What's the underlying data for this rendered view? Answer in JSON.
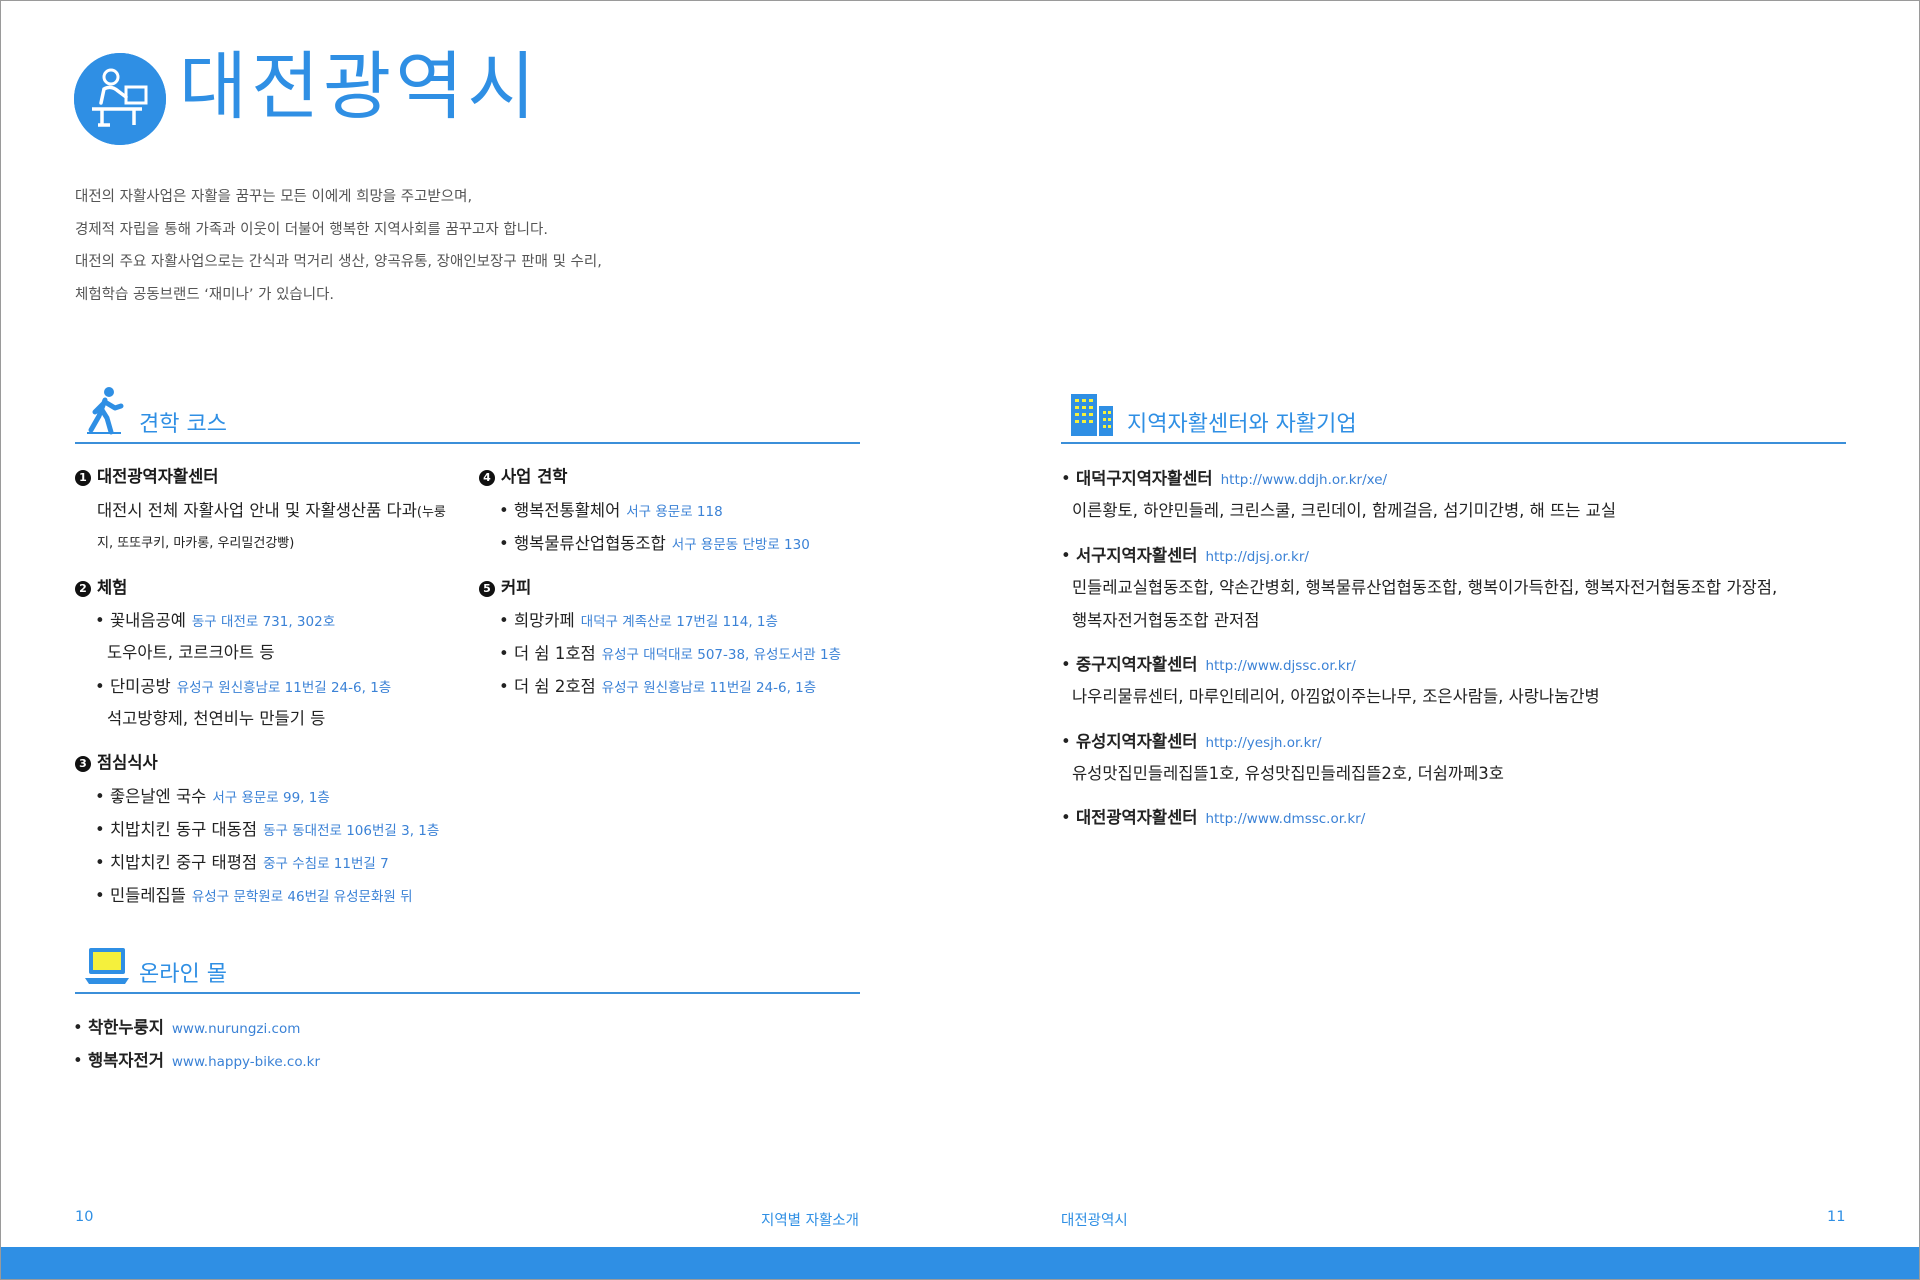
{
  "title": "대전광역시",
  "intro": [
    "대전의 자활사업은 자활을 꿈꾸는 모든 이에게 희망을 주고받으며,",
    "경제적 자립을 통해 가족과 이웃이 더불어 행복한 지역사회를 꿈꾸고자 합니다.",
    "대전의 주요 자활사업으로는 간식과 먹거리 생산, 양곡유통, 장애인보장구 판매 및 수리,",
    "체험학습 공동브랜드 ‘재미나’ 가 있습니다."
  ],
  "tour": {
    "title": "견학 코스",
    "s1": {
      "num": "1",
      "title": "대전광역자활센터",
      "desc1": "대전시 전체 자활사업 안내 및 자활생산품 다과",
      "desc1_small": "(누룽",
      "desc2": "지, 또또쿠키, 마카롱, 우리밀건강빵)"
    },
    "s2": {
      "num": "2",
      "title": "체험",
      "i1": {
        "name": "꽃내음공예",
        "addr": "동구 대전로 731, 302호",
        "sub": "도우아트, 코르크아트 등"
      },
      "i2": {
        "name": "단미공방",
        "addr": "유성구 원신흥남로 11번길 24-6, 1층",
        "sub": "석고방향제, 천연비누 만들기 등"
      }
    },
    "s3": {
      "num": "3",
      "title": "점심식사",
      "i1": {
        "name": "좋은날엔 국수",
        "addr": "서구 용문로 99, 1층"
      },
      "i2": {
        "name": "치밥치킨 동구 대동점",
        "addr": "동구 동대전로 106번길 3, 1층"
      },
      "i3": {
        "name": "치밥치킨 중구 태평점",
        "addr": "중구 수침로 11번길 7"
      },
      "i4": {
        "name": "민들레집뜰",
        "addr": "유성구 문학원로 46번길 유성문화원 뒤"
      }
    },
    "s4": {
      "num": "4",
      "title": "사업 견학",
      "i1": {
        "name": "행복전통활체어",
        "addr": "서구 용문로 118"
      },
      "i2": {
        "name": "행복물류산업협동조합",
        "addr": "서구 용문동 단방로 130"
      }
    },
    "s5": {
      "num": "5",
      "title": "커피",
      "i1": {
        "name": "희망카페",
        "addr": "대덕구 계족산로 17번길 114, 1층"
      },
      "i2": {
        "name": "더 쉼 1호점",
        "addr": "유성구 대덕대로 507-38, 유성도서관 1층"
      },
      "i3": {
        "name": "더 쉼 2호점",
        "addr": "유성구 원신흥남로 11번길 24-6, 1층"
      }
    }
  },
  "mall": {
    "title": "온라인 몰",
    "i1": {
      "name": "착한누룽지",
      "url": "www.nurungzi.com"
    },
    "i2": {
      "name": "행복자전거",
      "url": "www.happy-bike.co.kr"
    }
  },
  "centers": {
    "title": "지역자활센터와 자활기업",
    "c1": {
      "name": "대덕구지역자활센터",
      "url": "http://www.ddjh.or.kr/xe/",
      "desc": "이른황토, 하얀민들레, 크린스쿨, 크린데이, 함께걸음, 섬기미간병, 해 뜨는 교실"
    },
    "c2": {
      "name": "서구지역자활센터",
      "url": "http://djsj.or.kr/",
      "desc1": "민들레교실협동조합, 약손간병회, 행복물류산업협동조합, 행복이가득한집, 행복자전거협동조합 가장점,",
      "desc2": "행복자전거협동조합 관저점"
    },
    "c3": {
      "name": "중구지역자활센터",
      "url": "http://www.djssc.or.kr/",
      "desc": "나우리물류센터, 마루인테리어, 아낌없이주는나무, 조은사람들, 사랑나눔간병"
    },
    "c4": {
      "name": "유성지역자활센터",
      "url": "http://yesjh.or.kr/",
      "desc": "유성맛집민들레집뜰1호, 유성맛집민들레집뜰2호, 더쉼까페3호"
    },
    "c5": {
      "name": "대전광역자활센터",
      "url": "http://www.dmssc.or.kr/"
    }
  },
  "footer": {
    "left_page": "10",
    "left_label": "지역별 자활소개",
    "right_label": "대전광역시",
    "right_page": "11"
  },
  "colors": {
    "accent": "#2f8fe4",
    "link": "#3b82d6",
    "rule": "#3b8fd9"
  },
  "icons": {
    "title": "worker-logo-icon",
    "tour": "walking-person-icon",
    "mall": "laptop-icon",
    "centers": "buildings-icon"
  }
}
